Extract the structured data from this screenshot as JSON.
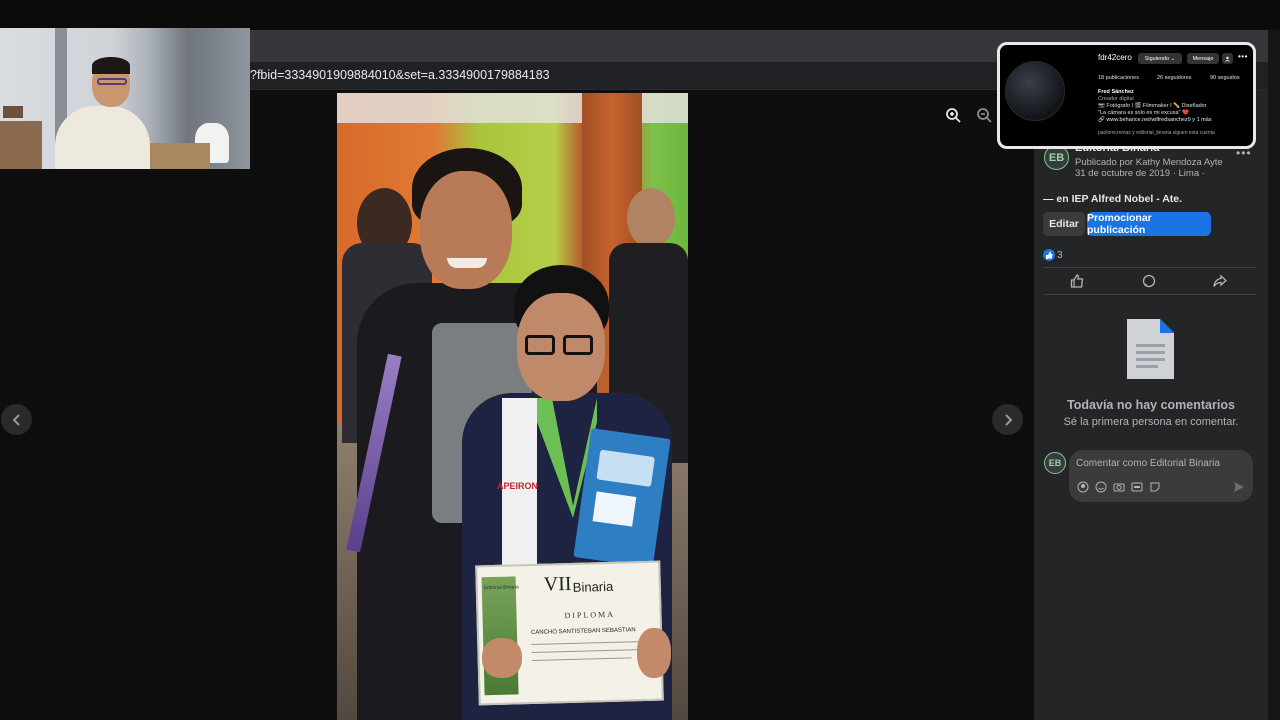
{
  "browser": {
    "url": "?fbid=3334901909884010&set=a.3334900179884183"
  },
  "viewer": {
    "prev_icon": "chevron-left-icon",
    "next_icon": "chevron-right-icon",
    "zoom_in_icon": "zoom-in-icon",
    "zoom_out_icon": "zoom-out-icon"
  },
  "photo": {
    "jacket_brand": "APEIRON",
    "diploma": {
      "edition": "VII",
      "brand": "Binaria",
      "heading": "DIPLOMA",
      "recipient": "CANCHO SANTISTEBAN SEBASTIAN",
      "logo_text": "Editorial Binaria"
    }
  },
  "post": {
    "page_name": "Editorial Binaria",
    "published_by": "Publicado por Kathy Mendoza Ayte",
    "date_line": "31 de octubre de 2019 · Lima ·",
    "location_line": "— en IEP Alfred Nobel - Ate.",
    "edit_label": "Editar",
    "promote_label": "Promocionar publicación",
    "reaction_count": "3",
    "no_comments_title": "Todavía no hay comentarios",
    "no_comments_sub": "Sé la primera persona en comentar.",
    "comment_placeholder": "Comentar como Editorial Binaria",
    "colors": {
      "promote": "#1b74e4",
      "edit_bg": "#3a3b3c",
      "panel_bg": "#242526"
    }
  },
  "instagram": {
    "username": "fdr42cero",
    "following_label": "Siguiendo ⌄",
    "message_label": "Mensaje",
    "posts": "18 publicaciones",
    "followers": "26 seguidores",
    "following": "90 seguidos",
    "name": "Fred Sánchez",
    "category": "Creador digital",
    "bio1": "📷 Fotógrafo I 🎬 Filmmaker I ✏️ Diseñador",
    "bio2": "\"La cámara es solo es mi excusa\" ❤️",
    "link": "🔗 www.behance.net/wilfredsanchez9 y 1 más",
    "followed_by": "paolomcremas y editorial_binaria siguen esta cuenta"
  }
}
